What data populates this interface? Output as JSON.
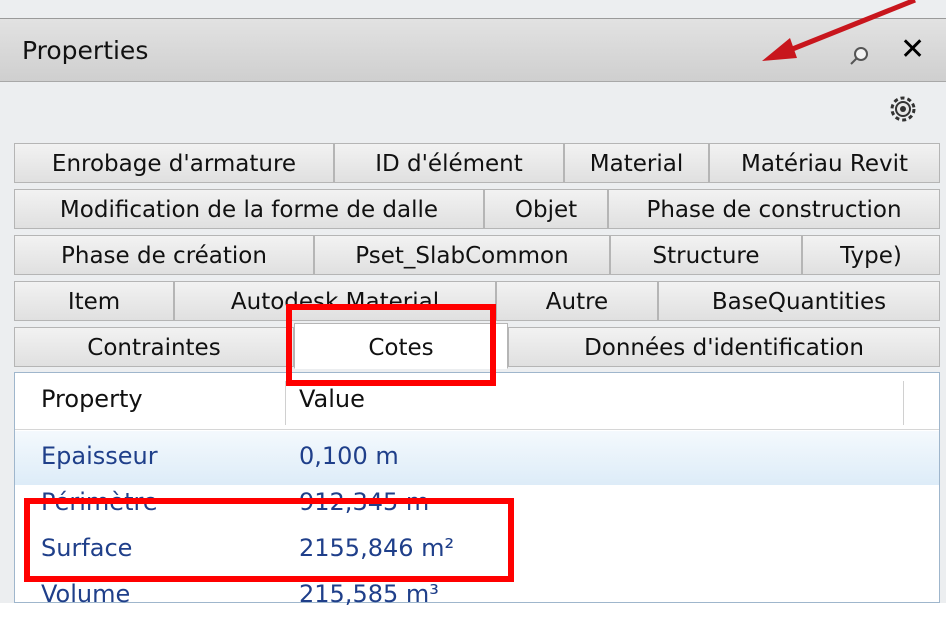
{
  "panel": {
    "title": "Properties",
    "pin_icon": "pin-icon",
    "close_label": "✕"
  },
  "tabs": {
    "rows": [
      [
        "Enrobage d'armature",
        "ID d'élément",
        "Material",
        "Matériau Revit"
      ],
      [
        "Modification de la forme de dalle",
        "Objet",
        "Phase de construction"
      ],
      [
        "Phase de création",
        "Pset_SlabCommon",
        "Structure",
        "Type)"
      ],
      [
        "Item",
        "Autodesk Material",
        "Autre",
        "BaseQuantities"
      ],
      [
        "Contraintes",
        "Cotes",
        "Données d'identification"
      ]
    ],
    "active": "Cotes"
  },
  "grid": {
    "columns": [
      "Property",
      "Value"
    ],
    "rows": [
      {
        "property": "Epaisseur",
        "value": "0,100 m"
      },
      {
        "property": "Périmètre",
        "value": "912,345 m"
      },
      {
        "property": "Surface",
        "value": "2155,846 m²"
      },
      {
        "property": "Volume",
        "value": "215,585 m³"
      }
    ],
    "selected_row": 0
  },
  "annotations": {
    "color": "#ff0000",
    "arrow_color": "#c8161d"
  }
}
